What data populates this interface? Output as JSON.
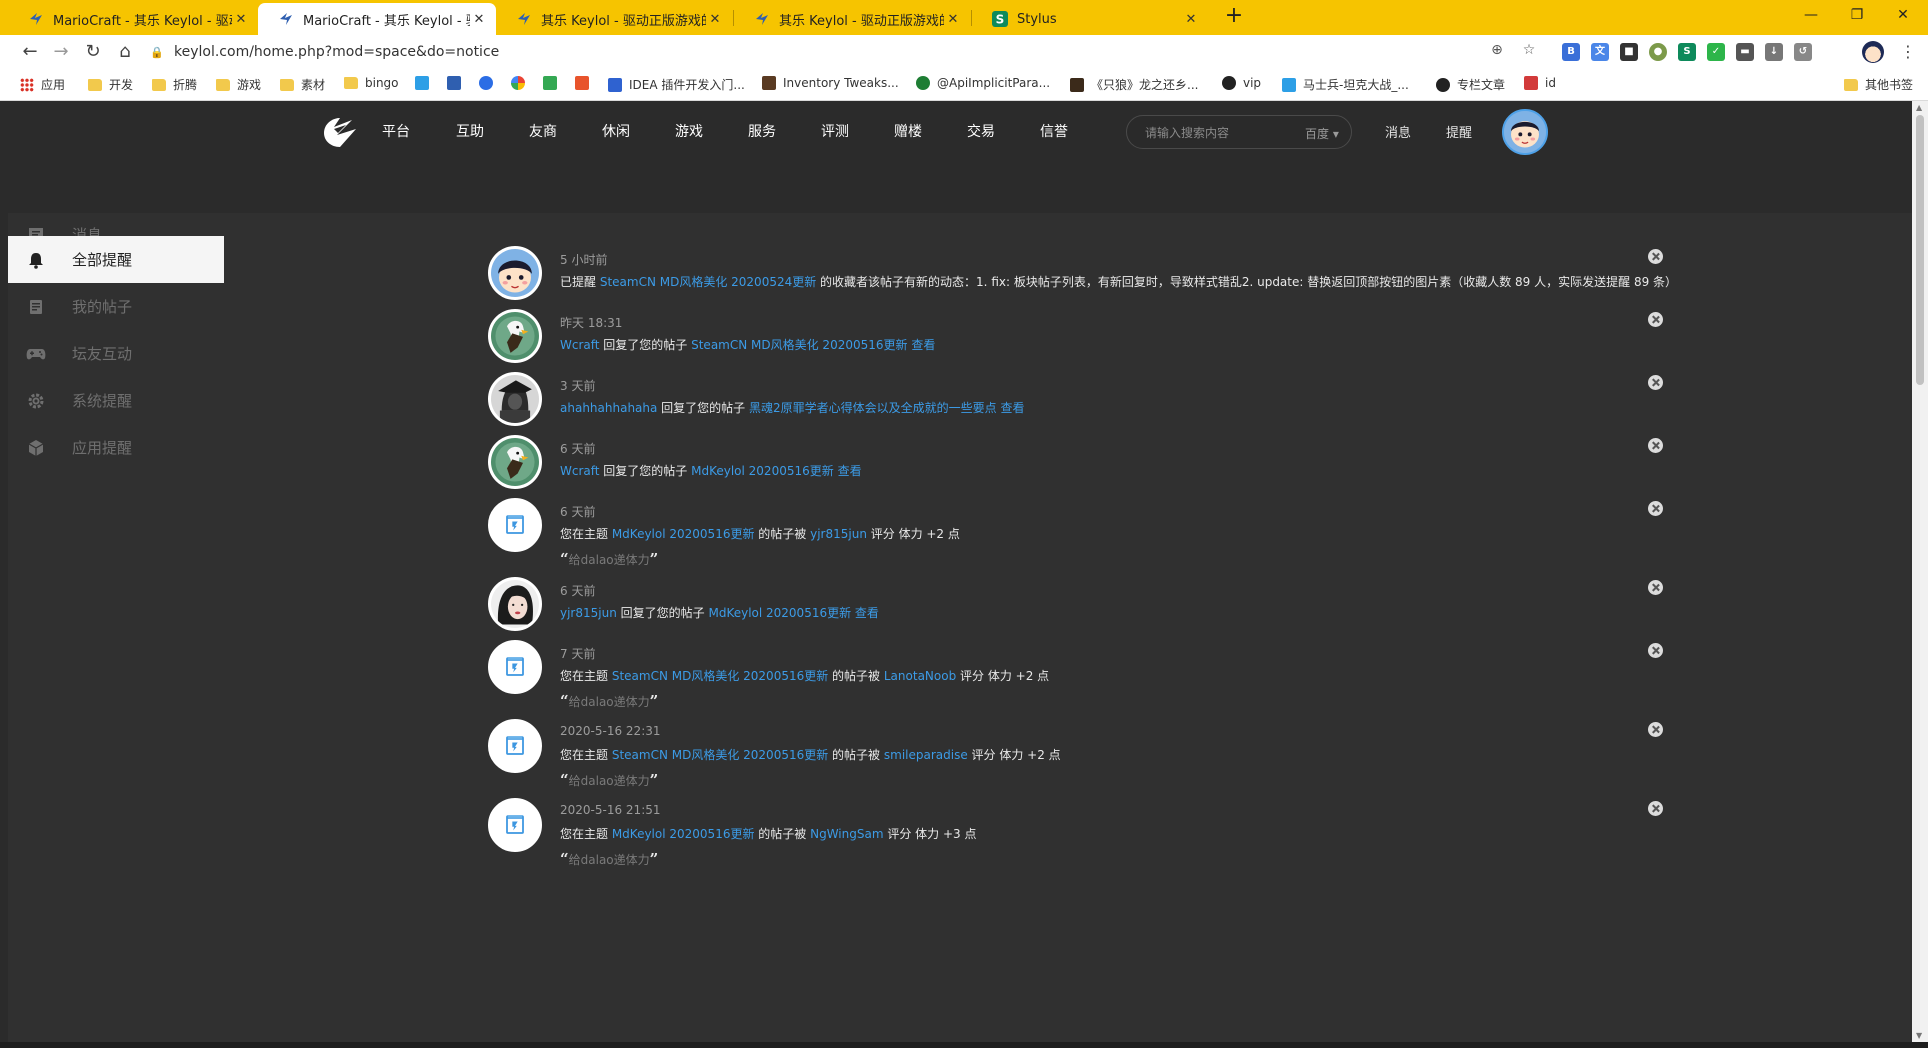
{
  "browser": {
    "tabs": [
      {
        "title": "MarioCraft - 其乐 Keylol - 驱动正版游戏的引擎！",
        "active": false
      },
      {
        "title": "MarioCraft - 其乐 Keylol - 驱动正版游戏的引擎！",
        "active": true
      },
      {
        "title": "其乐 Keylol - 驱动正版游戏的引擎！",
        "active": false
      },
      {
        "title": "其乐 Keylol - 驱动正版游戏的引擎！",
        "active": false
      },
      {
        "title": "Stylus",
        "active": false
      }
    ],
    "new_tab": "+",
    "url": "keylol.com/home.php?mod=space&do=notice",
    "bookmarks": [
      {
        "label": "应用",
        "type": "apps"
      },
      {
        "label": "开发",
        "type": "folder"
      },
      {
        "label": "折腾",
        "type": "folder"
      },
      {
        "label": "游戏",
        "type": "folder"
      },
      {
        "label": "素材",
        "type": "folder"
      },
      {
        "label": "bingo",
        "type": "folder"
      },
      {
        "label": "",
        "type": "bilibili"
      },
      {
        "label": "",
        "type": "keylol"
      },
      {
        "label": "",
        "type": "baidu"
      },
      {
        "label": "",
        "type": "google"
      },
      {
        "label": "",
        "type": "play"
      },
      {
        "label": "",
        "type": "red"
      },
      {
        "label": "IDEA 插件开发入门...",
        "type": "link"
      },
      {
        "label": "Inventory Tweaks...",
        "type": "link"
      },
      {
        "label": "@ApiImplicitPara...",
        "type": "link"
      },
      {
        "label": "《只狼》龙之还乡...",
        "type": "link"
      },
      {
        "label": "vip",
        "type": "link"
      },
      {
        "label": "马士兵-坦克大战_...",
        "type": "link"
      },
      {
        "label": "专栏文章",
        "type": "link"
      },
      {
        "label": "id",
        "type": "link"
      },
      {
        "label": "其他书签",
        "type": "folder"
      }
    ]
  },
  "site": {
    "nav": [
      "平台",
      "互助",
      "友商",
      "休闲",
      "游戏",
      "服务",
      "评测",
      "赠楼",
      "交易",
      "信誉"
    ],
    "search_placeholder": "请输入搜索内容",
    "search_engine": "百度",
    "messages_link": "消息",
    "notice_link": "提醒"
  },
  "sidebar": [
    {
      "label": "消息",
      "icon": "message-icon",
      "active": false
    },
    {
      "label": "全部提醒",
      "icon": "bell-icon",
      "active": true
    },
    {
      "label": "我的帖子",
      "icon": "post-icon",
      "active": false
    },
    {
      "label": "坛友互动",
      "icon": "gamepad-icon",
      "active": false
    },
    {
      "label": "系统提醒",
      "icon": "gear-icon",
      "active": false
    },
    {
      "label": "应用提醒",
      "icon": "cube-icon",
      "active": false
    }
  ],
  "notifications": [
    {
      "time": "5 小时前",
      "avatar": "boy",
      "parts": [
        {
          "t": "已提醒 "
        },
        {
          "t": "SteamCN MD风格美化 20200524更新",
          "link": true
        },
        {
          "t": " 的收藏者该帖子有新的动态：1. fix: 板块帖子列表，有新回复时，导致样式错乱2. update: 替换返回顶部按钮的图片素（收藏人数 89 人，实际发送提醒 89 条）"
        }
      ]
    },
    {
      "time": "昨天 18:31",
      "avatar": "eagle",
      "parts": [
        {
          "t": "Wcraft",
          "link": true
        },
        {
          "t": " 回复了您的帖子 "
        },
        {
          "t": "SteamCN MD风格美化 20200516更新",
          "link": true
        },
        {
          "t": "  查看",
          "link": true
        }
      ]
    },
    {
      "time": "3 天前",
      "avatar": "dark",
      "parts": [
        {
          "t": "ahahhahhahaha",
          "link": true
        },
        {
          "t": " 回复了您的帖子 "
        },
        {
          "t": "黑魂2原罪学者心得体会以及全成就的一些要点",
          "link": true
        },
        {
          "t": "  查看",
          "link": true
        }
      ]
    },
    {
      "time": "6 天前",
      "avatar": "eagle",
      "parts": [
        {
          "t": "Wcraft",
          "link": true
        },
        {
          "t": " 回复了您的帖子 "
        },
        {
          "t": "MdKeylol 20200516更新",
          "link": true
        },
        {
          "t": "  查看",
          "link": true
        }
      ]
    },
    {
      "time": "6 天前",
      "avatar": "system",
      "parts": [
        {
          "t": "您在主题 "
        },
        {
          "t": "MdKeylol 20200516更新",
          "link": true
        },
        {
          "t": " 的帖子被 "
        },
        {
          "t": "yjr815jun",
          "link": true
        },
        {
          "t": " 评分 体力 +2 点"
        }
      ],
      "quote": "给dalao递体力"
    },
    {
      "time": "6 天前",
      "avatar": "girl",
      "parts": [
        {
          "t": "yjr815jun",
          "link": true
        },
        {
          "t": " 回复了您的帖子 "
        },
        {
          "t": "MdKeylol 20200516更新",
          "link": true
        },
        {
          "t": "  查看",
          "link": true
        }
      ]
    },
    {
      "time": "7 天前",
      "avatar": "system",
      "parts": [
        {
          "t": "您在主题 "
        },
        {
          "t": "SteamCN MD风格美化 20200516更新",
          "link": true
        },
        {
          "t": " 的帖子被 "
        },
        {
          "t": "LanotaNoob",
          "link": true
        },
        {
          "t": " 评分 体力 +2 点"
        }
      ],
      "quote": "给dalao递体力"
    },
    {
      "time": "2020-5-16 22:31",
      "avatar": "system",
      "parts": [
        {
          "t": "您在主题 "
        },
        {
          "t": "SteamCN MD风格美化 20200516更新",
          "link": true
        },
        {
          "t": " 的帖子被 "
        },
        {
          "t": "smileparadise",
          "link": true
        },
        {
          "t": " 评分 体力 +2 点"
        }
      ],
      "quote": "给dalao递体力"
    },
    {
      "time": "2020-5-16 21:51",
      "avatar": "system",
      "parts": [
        {
          "t": "您在主题 "
        },
        {
          "t": "MdKeylol 20200516更新",
          "link": true
        },
        {
          "t": " 的帖子被 "
        },
        {
          "t": "NgWingSam",
          "link": true
        },
        {
          "t": " 评分 体力 +3 点"
        }
      ],
      "quote": "给dalao递体力"
    }
  ],
  "colors": {
    "link": "#3c9be6",
    "tabbar": "#f6c400",
    "page_bg": "#303030",
    "header_bg": "#2b2b2b"
  }
}
